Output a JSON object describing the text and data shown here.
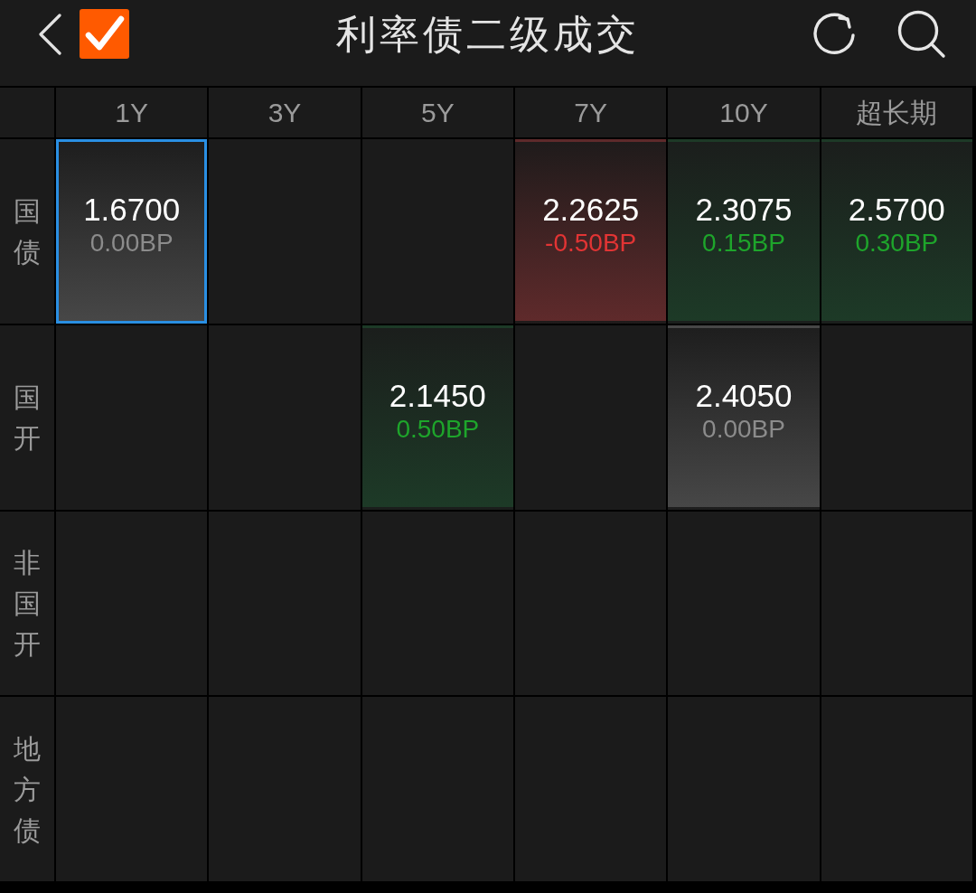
{
  "header": {
    "checkbox": {
      "checked": true
    },
    "title": "利率债二级成交"
  },
  "grid": {
    "columns": [
      "1Y",
      "3Y",
      "5Y",
      "7Y",
      "10Y",
      "超长期"
    ],
    "rows": [
      {
        "label": "国债",
        "cells": [
          {
            "kind": "flat",
            "yield": "1.6700",
            "change": "0.00BP",
            "selected": true
          },
          {
            "kind": "empty",
            "selected": false
          },
          {
            "kind": "empty",
            "selected": false
          },
          {
            "kind": "fall",
            "yield": "2.2625",
            "change": "-0.50BP",
            "selected": false
          },
          {
            "kind": "rise",
            "yield": "2.3075",
            "change": "0.15BP",
            "selected": false
          },
          {
            "kind": "rise",
            "yield": "2.5700",
            "change": "0.30BP",
            "selected": false
          }
        ]
      },
      {
        "label": "国开",
        "cells": [
          {
            "kind": "empty",
            "selected": false
          },
          {
            "kind": "empty",
            "selected": false
          },
          {
            "kind": "rise",
            "yield": "2.1450",
            "change": "0.50BP",
            "selected": false
          },
          {
            "kind": "empty",
            "selected": false
          },
          {
            "kind": "flat",
            "yield": "2.4050",
            "change": "0.00BP",
            "selected": false
          },
          {
            "kind": "empty",
            "selected": false
          }
        ]
      },
      {
        "label": "非国开",
        "cells": [
          {
            "kind": "empty",
            "selected": false
          },
          {
            "kind": "empty",
            "selected": false
          },
          {
            "kind": "empty",
            "selected": false
          },
          {
            "kind": "empty",
            "selected": false
          },
          {
            "kind": "empty",
            "selected": false
          },
          {
            "kind": "empty",
            "selected": false
          }
        ]
      },
      {
        "label": "地方债",
        "cells": [
          {
            "kind": "empty",
            "selected": false
          },
          {
            "kind": "empty",
            "selected": false
          },
          {
            "kind": "empty",
            "selected": false
          },
          {
            "kind": "empty",
            "selected": false
          },
          {
            "kind": "empty",
            "selected": false
          },
          {
            "kind": "empty",
            "selected": false
          }
        ]
      }
    ]
  }
}
